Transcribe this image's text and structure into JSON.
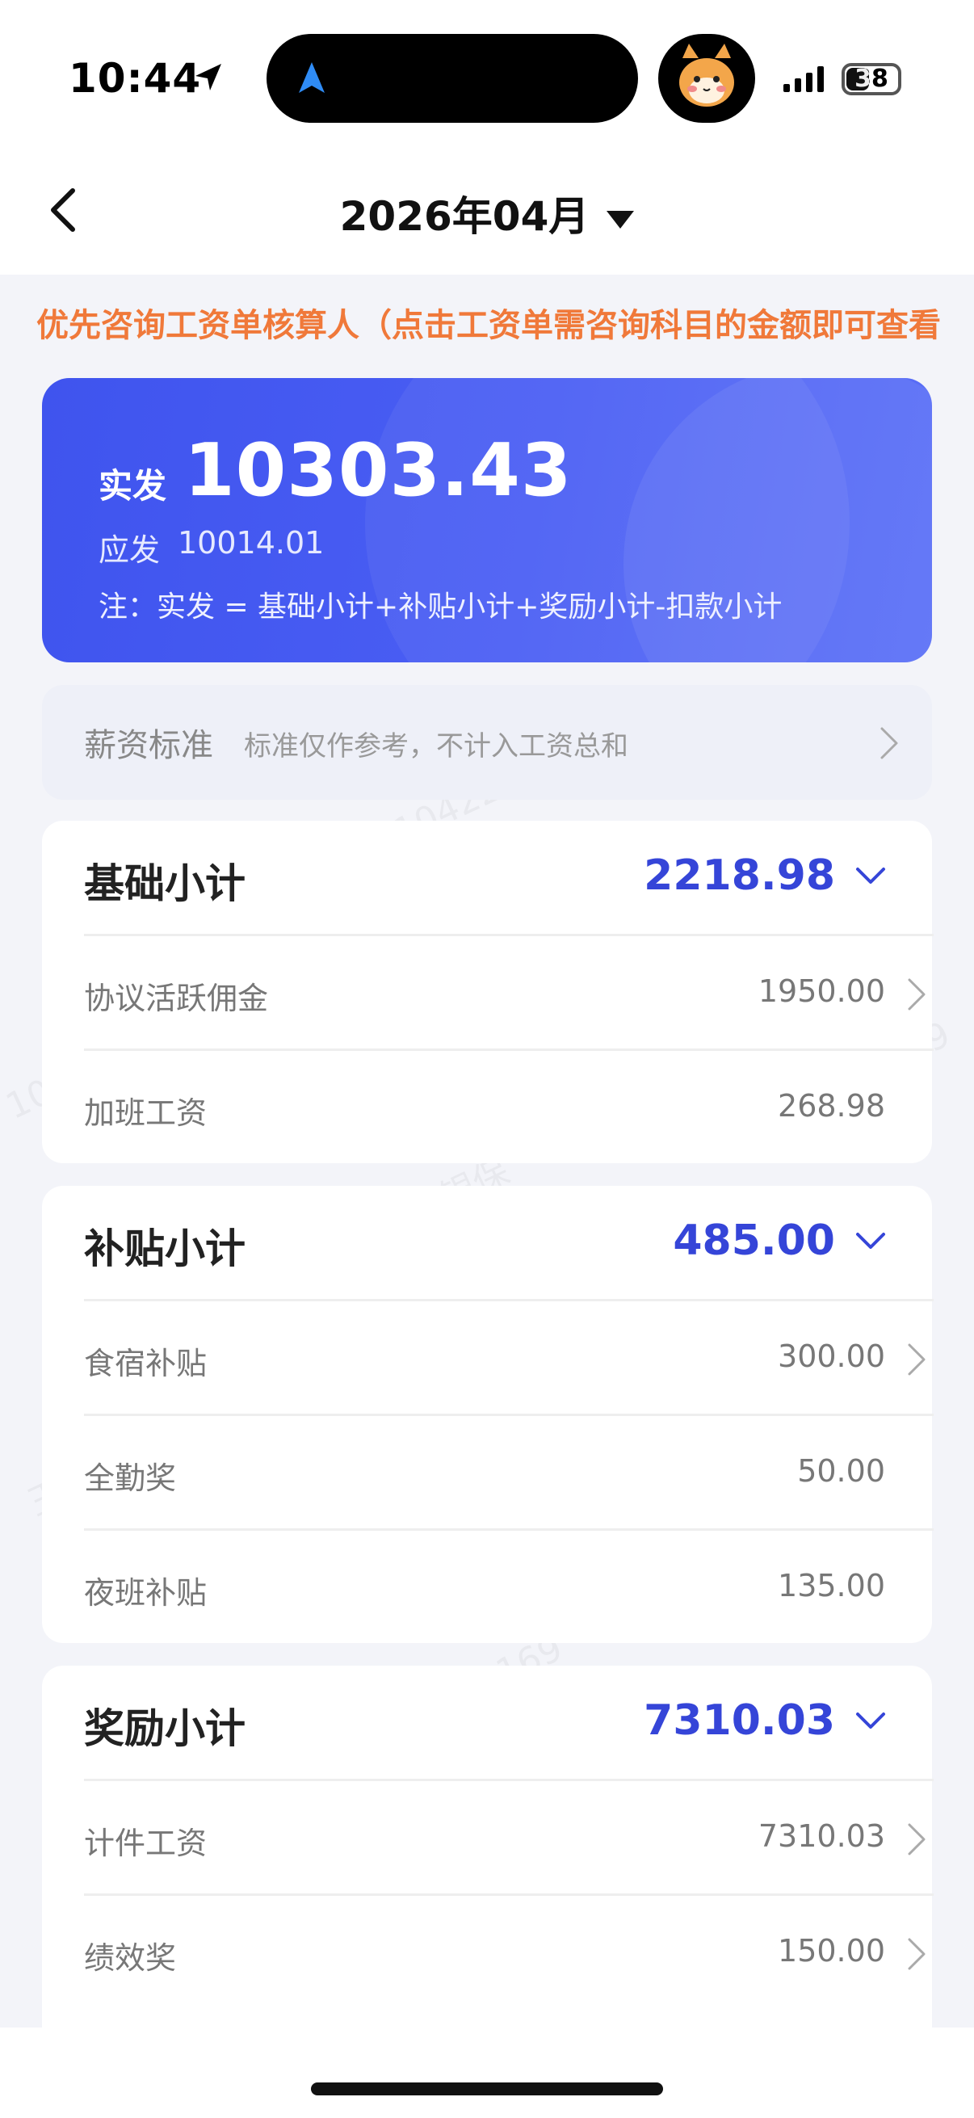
{
  "status_bar": {
    "time": "10:44",
    "battery": "38"
  },
  "header": {
    "month": "2026年04月"
  },
  "notice": {
    "text": "优先咨询工资单核算人（点击工资单需咨询科目的金额即可查看"
  },
  "summary": {
    "net_label": "实发",
    "net_value": "10303.43",
    "gross_label": "应发",
    "gross_value": "10014.01",
    "formula": "注：实发 = 基础小计+补贴小计+奖励小计-扣款小计"
  },
  "standard": {
    "title": "薪资标准",
    "subtitle": "标准仅作参考，不计入工资总和"
  },
  "sections": [
    {
      "title": "基础小计",
      "total": "2218.98",
      "items": [
        {
          "label": "协议活跃佣金",
          "value": "1950.00"
        },
        {
          "label": "加班工资",
          "value": "268.98"
        }
      ]
    },
    {
      "title": "补贴小计",
      "total": "485.00",
      "items": [
        {
          "label": "食宿补贴",
          "value": "300.00"
        },
        {
          "label": "全勤奖",
          "value": "50.00"
        },
        {
          "label": "夜班补贴",
          "value": "135.00"
        }
      ]
    },
    {
      "title": "奖励小计",
      "total": "7310.03",
      "items": [
        {
          "label": "计件工资",
          "value": "7310.03"
        },
        {
          "label": "绩效奖",
          "value": "150.00"
        }
      ]
    }
  ],
  "watermark": {
    "name": "王银保",
    "id": "10422169"
  },
  "colors": {
    "accent": "#3545d8",
    "card": "#4a5ef4",
    "notice": "#f0793a"
  }
}
